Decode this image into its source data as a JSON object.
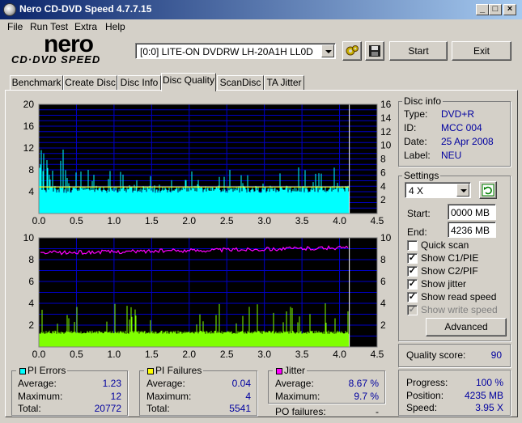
{
  "window": {
    "title": "Nero CD-DVD Speed 4.7.7.15"
  },
  "menu": [
    "File",
    "Run Test",
    "Extra",
    "Help"
  ],
  "logo": {
    "nero": "nero",
    "sub": "CD·DVD SPEED"
  },
  "drive": {
    "selected": "[0:0]   LITE-ON DVDRW LH-20A1H LL0D"
  },
  "buttons": {
    "start": "Start",
    "exit": "Exit",
    "advanced": "Advanced"
  },
  "tabs": [
    "Benchmark",
    "Create Disc",
    "Disc Info",
    "Disc Quality",
    "ScanDisc",
    "TA Jitter"
  ],
  "active_tab": "Disc Quality",
  "disc_info": {
    "title": "Disc info",
    "type_label": "Type:",
    "type": "DVD+R",
    "id_label": "ID:",
    "id": "MCC 004",
    "date_label": "Date:",
    "date": "25 Apr 2008",
    "label_label": "Label:",
    "label": "NEU"
  },
  "settings": {
    "title": "Settings",
    "speed": "4 X",
    "start_label": "Start:",
    "start": "0000 MB",
    "end_label": "End:",
    "end": "4236 MB",
    "options": [
      {
        "label": "Quick scan",
        "checked": false,
        "enabled": true
      },
      {
        "label": "Show C1/PIE",
        "checked": true,
        "enabled": true
      },
      {
        "label": "Show C2/PIF",
        "checked": true,
        "enabled": true
      },
      {
        "label": "Show jitter",
        "checked": true,
        "enabled": true
      },
      {
        "label": "Show read speed",
        "checked": true,
        "enabled": true
      },
      {
        "label": "Show write speed",
        "checked": true,
        "enabled": false
      }
    ]
  },
  "quality": {
    "label": "Quality score:",
    "value": "90"
  },
  "progress": {
    "progress_label": "Progress:",
    "progress": "100 %",
    "position_label": "Position:",
    "position": "4235 MB",
    "speed_label": "Speed:",
    "speed": "3.95 X"
  },
  "pi_errors": {
    "title": "PI Errors",
    "avg_label": "Average:",
    "avg": "1.23",
    "max_label": "Maximum:",
    "max": "12",
    "total_label": "Total:",
    "total": "20772"
  },
  "pi_failures": {
    "title": "PI Failures",
    "avg_label": "Average:",
    "avg": "0.04",
    "max_label": "Maximum:",
    "max": "4",
    "total_label": "Total:",
    "total": "5541"
  },
  "jitter": {
    "title": "Jitter",
    "avg_label": "Average:",
    "avg": "8.67 %",
    "max_label": "Maximum:",
    "max": "9.7 %"
  },
  "po_failures": {
    "label": "PO failures:",
    "value": "-"
  },
  "colors": {
    "pie": "#00ffff",
    "pif": "#80ff00",
    "jitter": "#ff00ff",
    "speed": "#ffff00",
    "plot_bg": "#000000",
    "grid": "#0000c0",
    "window_bg": "#d4d0c8",
    "title_blue": "#0a246a"
  },
  "chart_data": [
    {
      "type": "bar",
      "x_ticks": [
        "0.0",
        "0.5",
        "1.0",
        "1.5",
        "2.0",
        "2.5",
        "3.0",
        "3.5",
        "4.0",
        "4.5"
      ],
      "left_ticks": [
        "20",
        "16",
        "12",
        "8",
        "4"
      ],
      "right_ticks": [
        "16",
        "14",
        "12",
        "10",
        "8",
        "6",
        "4",
        "2"
      ],
      "xlim": [
        0,
        4.5
      ],
      "ylim_left": [
        0,
        20
      ],
      "ylim_right": [
        0,
        16
      ],
      "end_x": 4.13,
      "series": [
        {
          "color": "#00ffff",
          "base": 4.2,
          "peak": 12,
          "ends_at": 4.13
        },
        {
          "color": "#ffff00",
          "values_x": [
            0,
            1,
            2,
            3,
            4,
            4.13
          ],
          "values_y": [
            3.9,
            3.9,
            3.9,
            3.9,
            3.9,
            3.9
          ]
        }
      ],
      "grid": true
    },
    {
      "type": "bar",
      "x_ticks": [
        "0.0",
        "0.5",
        "1.0",
        "1.5",
        "2.0",
        "2.5",
        "3.0",
        "3.5",
        "4.0",
        "4.5"
      ],
      "left_ticks": [
        "10",
        "8",
        "6",
        "4",
        "2"
      ],
      "right_ticks": [
        "10",
        "8",
        "6",
        "4",
        "2"
      ],
      "xlim": [
        0,
        4.5
      ],
      "ylim_left": [
        0,
        10
      ],
      "ylim_right": [
        0,
        10
      ],
      "end_x": 4.13,
      "series": [
        {
          "color": "#80ff00",
          "base": 1.5,
          "peak": 4,
          "ends_at": 4.13
        },
        {
          "color": "#ff00ff",
          "start": 8.6,
          "end": 9.1,
          "ends_at": 4.13
        }
      ],
      "grid": true
    }
  ]
}
